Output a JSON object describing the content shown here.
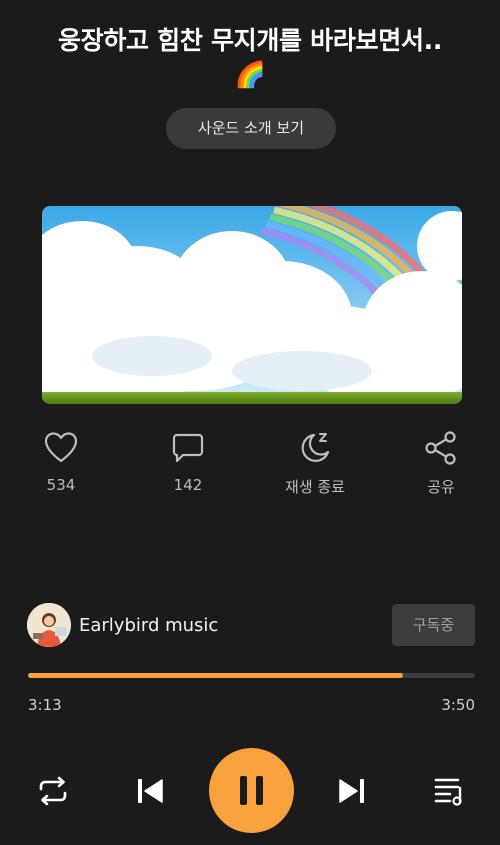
{
  "track": {
    "title": "웅장하고 힘찬 무지개를 바라보면서..",
    "title_emoji": "🌈"
  },
  "sound_intro_label": "사운드 소개 보기",
  "actions": {
    "like_count": "534",
    "comment_count": "142",
    "sleep_timer_label": "재생 종료",
    "share_label": "공유"
  },
  "channel": {
    "name": "Earlybird music",
    "subscribe_label": "구독중"
  },
  "playback": {
    "elapsed": "3:13",
    "total": "3:50",
    "progress_fraction": 0.84
  },
  "icons": {
    "like": "heart-icon",
    "comment": "comment-icon",
    "sleep": "moon-sleep-icon",
    "share": "share-icon",
    "repeat": "repeat-icon",
    "previous": "skip-previous-icon",
    "pause": "pause-icon",
    "next": "skip-next-icon",
    "playlist": "playlist-icon"
  },
  "colors": {
    "accent": "#f7a23c",
    "background": "#1b1b1b"
  }
}
